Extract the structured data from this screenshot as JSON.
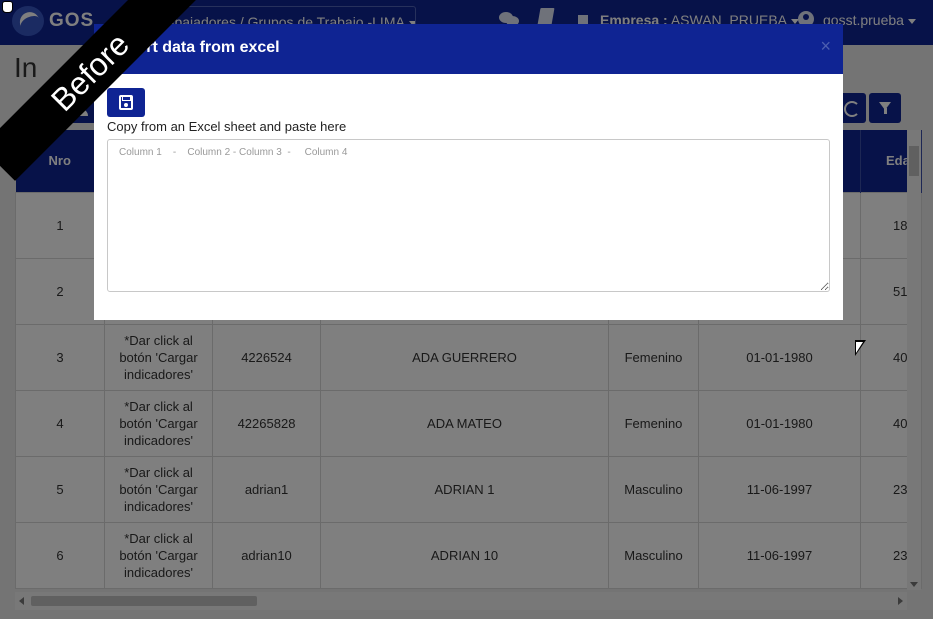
{
  "navbar": {
    "logo_text": "GOS",
    "breadcrumb": "Trabajadores / Grupos de Trabajo -LIMA",
    "company_label": "Empresa :",
    "company_name": "ASWAN_PRUEBA",
    "user": "gosst.prueba",
    "icons": [
      "chat-icon",
      "book-icon",
      "building-icon",
      "user-icon"
    ]
  },
  "page": {
    "title": "In"
  },
  "table": {
    "headers": [
      "Nro",
      "",
      "",
      "",
      "",
      "",
      "Edad"
    ],
    "rows": [
      {
        "nro": "1",
        "ind": "",
        "doc": "",
        "name": "",
        "sex": "",
        "date": "",
        "edad": "18"
      },
      {
        "nro": "2",
        "ind": "",
        "doc": "",
        "name": "",
        "sex": "",
        "date": "",
        "edad": "51"
      },
      {
        "nro": "3",
        "ind": "*Dar click al botón 'Cargar indicadores'",
        "doc": "4226524",
        "name": "ADA GUERRERO",
        "sex": "Femenino",
        "date": "01-01-1980",
        "edad": "40"
      },
      {
        "nro": "4",
        "ind": "*Dar click al botón 'Cargar indicadores'",
        "doc": "42265828",
        "name": "ADA MATEO",
        "sex": "Femenino",
        "date": "01-01-1980",
        "edad": "40"
      },
      {
        "nro": "5",
        "ind": "*Dar click al botón 'Cargar indicadores'",
        "doc": "adrian1",
        "name": "ADRIAN 1",
        "sex": "Masculino",
        "date": "11-06-1997",
        "edad": "23"
      },
      {
        "nro": "6",
        "ind": "*Dar click al botón 'Cargar indicadores'",
        "doc": "adrian10",
        "name": "ADRIAN 10",
        "sex": "Masculino",
        "date": "11-06-1997",
        "edad": "23"
      }
    ]
  },
  "modal": {
    "title": "Import data from excel",
    "close_label": "×",
    "save_icon": "floppy-disk-icon",
    "paste_label": "Copy from an Excel sheet and paste here",
    "paste_placeholder": "Column 1    -    Column 2 - Column 3  -     Column 4",
    "paste_value": ""
  },
  "overlay": {
    "ribbon_text": "Before"
  },
  "colors": {
    "primary": "#0f2493",
    "backdrop": "rgba(0,0,0,0.5)"
  }
}
